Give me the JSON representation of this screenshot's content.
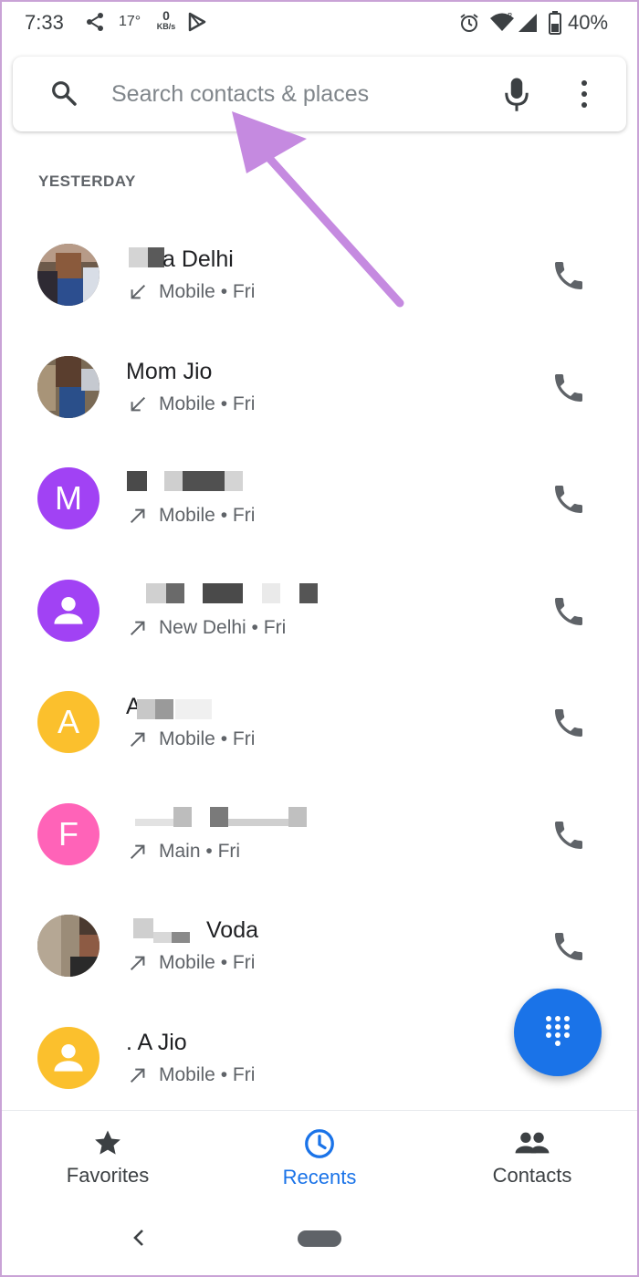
{
  "status_bar": {
    "time": "7:33",
    "temperature": "17°",
    "net_speed_value": "0",
    "net_speed_unit": "KB/s",
    "battery_percent": "40%"
  },
  "search": {
    "placeholder": "Search contacts & places"
  },
  "section_header": "YESTERDAY",
  "calls": [
    {
      "name": "a Delhi",
      "avatar_type": "photo",
      "direction": "incoming",
      "type": "Mobile",
      "day": "Fri"
    },
    {
      "name": "Mom Jio",
      "avatar_type": "photo",
      "direction": "incoming",
      "type": "Mobile",
      "day": "Fri"
    },
    {
      "name": "",
      "avatar_type": "letter",
      "avatar_letter": "M",
      "avatar_color": "#a142f4",
      "direction": "outgoing",
      "type": "Mobile",
      "day": "Fri"
    },
    {
      "name": "",
      "avatar_type": "person",
      "avatar_color": "#a142f4",
      "direction": "outgoing",
      "type": "New Delhi",
      "day": "Fri"
    },
    {
      "name": "A",
      "avatar_type": "letter",
      "avatar_letter": "A",
      "avatar_color": "#fbc02d",
      "direction": "outgoing",
      "type": "Mobile",
      "day": "Fri"
    },
    {
      "name": "",
      "avatar_type": "letter",
      "avatar_letter": "F",
      "avatar_color": "#ff63b8",
      "direction": "outgoing",
      "type": "Main",
      "day": "Fri"
    },
    {
      "name": "Voda",
      "avatar_type": "photo",
      "direction": "outgoing",
      "type": "Mobile",
      "day": "Fri"
    },
    {
      "name": ". A Jio",
      "avatar_type": "person",
      "avatar_color": "#fbc02d",
      "direction": "outgoing",
      "type": "Mobile",
      "day": "Fri"
    }
  ],
  "meta_separator": "•",
  "bottom_nav": {
    "favorites": "Favorites",
    "recents": "Recents",
    "contacts": "Contacts",
    "active": "recents"
  },
  "colors": {
    "accent": "#1a73e8",
    "annotation": "#c58ae0",
    "icon_gray": "#5f6368"
  }
}
